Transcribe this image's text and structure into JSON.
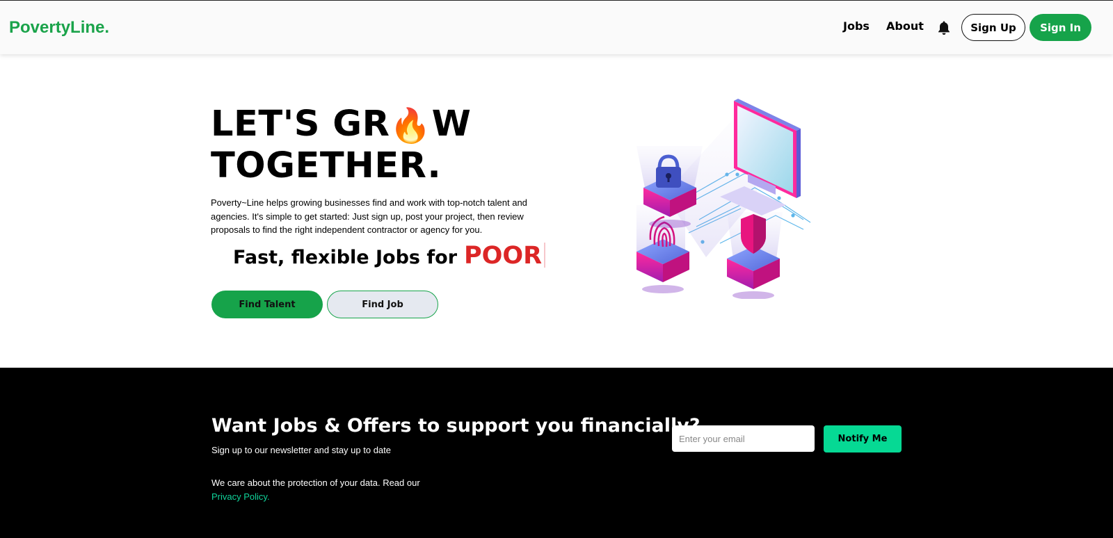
{
  "header": {
    "logo": "PovertyLine.",
    "nav": {
      "jobs": "Jobs",
      "about": "About"
    },
    "notification_icon": "bell-icon",
    "sign_up": "Sign Up",
    "sign_in": "Sign In"
  },
  "hero": {
    "title_part1": "LET'S GR",
    "title_emoji": "🔥",
    "title_part2": "W",
    "title_line2": "TOGETHER.",
    "description": "Poverty~Line helps growing businesses find and work with top-notch talent and agencies. It's simple to get started: Just sign up, post your project, then review proposals to find the right independent contractor or agency for you.",
    "tagline_prefix": "Fast, flexible Jobs for",
    "tagline_word": "POOR",
    "find_talent": "Find Talent",
    "find_job": "Find Job",
    "illustration_icons": [
      "monitor-icon",
      "lock-icon",
      "fingerprint-icon",
      "shield-icon"
    ]
  },
  "newsletter": {
    "title": "Want Jobs & Offers to support you financially?",
    "subtitle": "Sign up to our newsletter and stay up to date",
    "email_placeholder": "Enter your email",
    "notify_button": "Notify Me",
    "privacy_text": "We care about the protection of your data. Read our",
    "privacy_link": "Privacy Policy."
  },
  "colors": {
    "brand_green": "#16a34a",
    "notify_green": "#06d994",
    "tagline_red": "#dc2626",
    "footer_bg": "#000000"
  }
}
